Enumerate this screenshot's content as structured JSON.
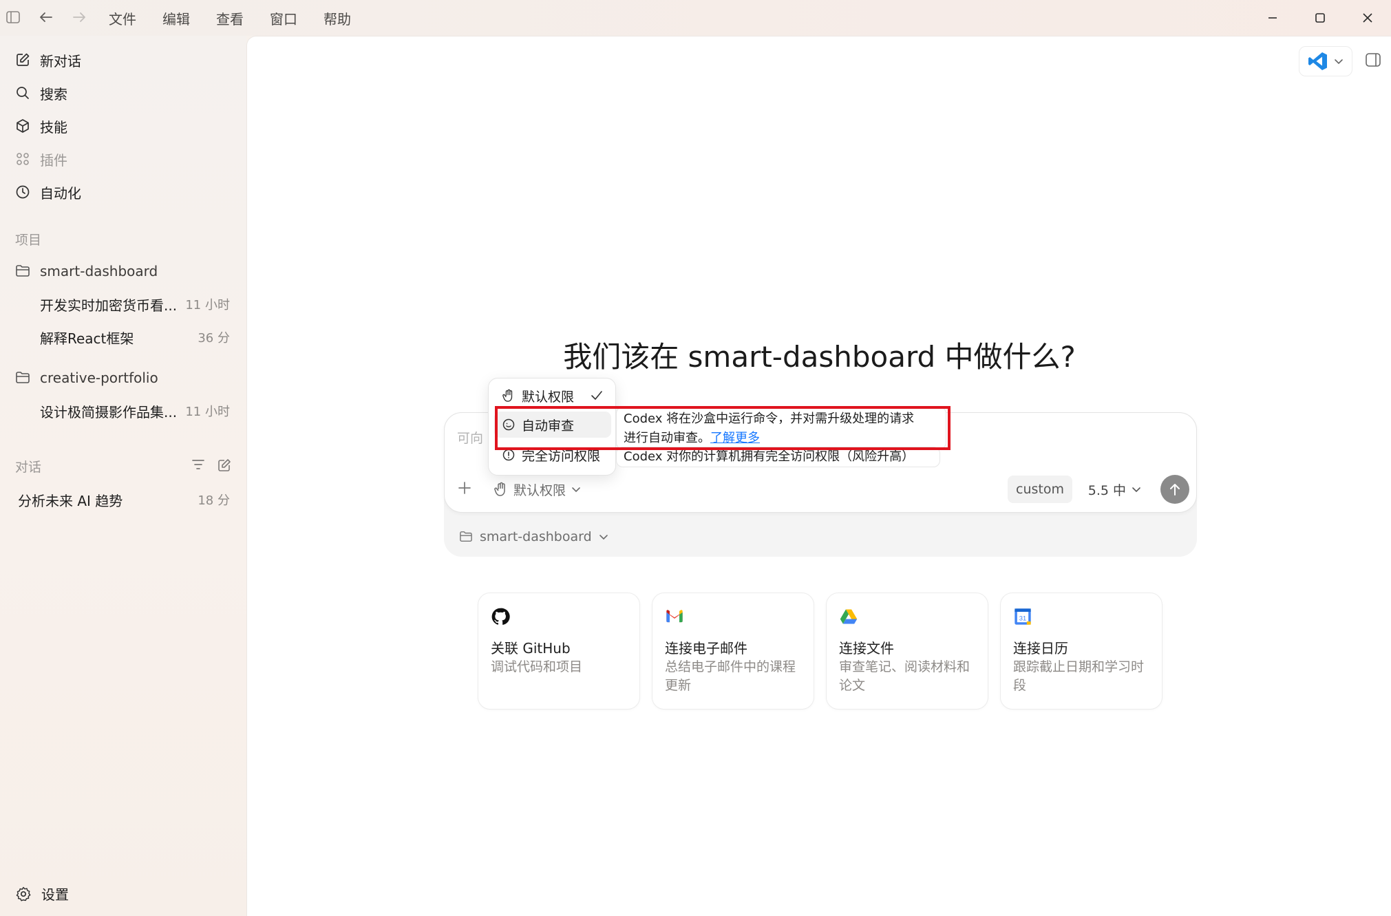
{
  "menu": [
    "文件",
    "编辑",
    "查看",
    "窗口",
    "帮助"
  ],
  "sidebar": {
    "nav": [
      {
        "label": "新对话",
        "icon": "edit-icon",
        "disabled": false
      },
      {
        "label": "搜索",
        "icon": "search-icon",
        "disabled": false
      },
      {
        "label": "技能",
        "icon": "cube-icon",
        "disabled": false
      },
      {
        "label": "插件",
        "icon": "grid-icon",
        "disabled": true
      },
      {
        "label": "自动化",
        "icon": "clock-icon",
        "disabled": false
      }
    ],
    "projects_label": "项目",
    "projects": [
      {
        "name": "smart-dashboard",
        "threads": [
          {
            "title": "开发实时加密货币看...",
            "time": "11 小时"
          },
          {
            "title": "解释React框架",
            "time": "36 分"
          }
        ]
      },
      {
        "name": "creative-portfolio",
        "threads": [
          {
            "title": "设计极简摄影作品集...",
            "time": "11 小时"
          }
        ]
      }
    ],
    "conversations_label": "对话",
    "conversations": [
      {
        "title": "分析未来 AI 趋势",
        "time": "18 分"
      }
    ],
    "settings_label": "设置"
  },
  "main": {
    "headline": "我们该在 smart-dashboard 中做什么?",
    "composer": {
      "placeholder": "可向",
      "permission_label": "默认权限",
      "custom_label": "custom",
      "model_label": "5.5 中",
      "project_label": "smart-dashboard"
    },
    "permissions_menu": [
      {
        "label": "默认权限",
        "icon": "hand-icon",
        "checked": true
      },
      {
        "label": "自动审查",
        "icon": "shield-smile-icon",
        "checked": false
      },
      {
        "label": "完全访问权限",
        "icon": "alert-circle-icon",
        "checked": false
      }
    ],
    "tips": {
      "auto_review_line1": "Codex 将在沙盒中运行命令，并对需升级处理的请求",
      "auto_review_line2": "进行自动审查。",
      "learn_more": "了解更多",
      "full_access": "Codex 对你的计算机拥有完全访问权限（风险升高）"
    },
    "cards": [
      {
        "title": "关联 GitHub",
        "desc": "调试代码和项目",
        "icon": "github-icon"
      },
      {
        "title": "连接电子邮件",
        "desc": "总结电子邮件中的课程更新",
        "icon": "gmail-icon"
      },
      {
        "title": "连接文件",
        "desc": "审查笔记、阅读材料和论文",
        "icon": "drive-icon"
      },
      {
        "title": "连接日历",
        "desc": "跟踪截止日期和学习时段",
        "icon": "calendar-icon"
      }
    ],
    "calendar_day": "31"
  },
  "colors": {
    "highlight": "#e0141e",
    "link": "#1677ff",
    "send": "#8a8a8a"
  }
}
